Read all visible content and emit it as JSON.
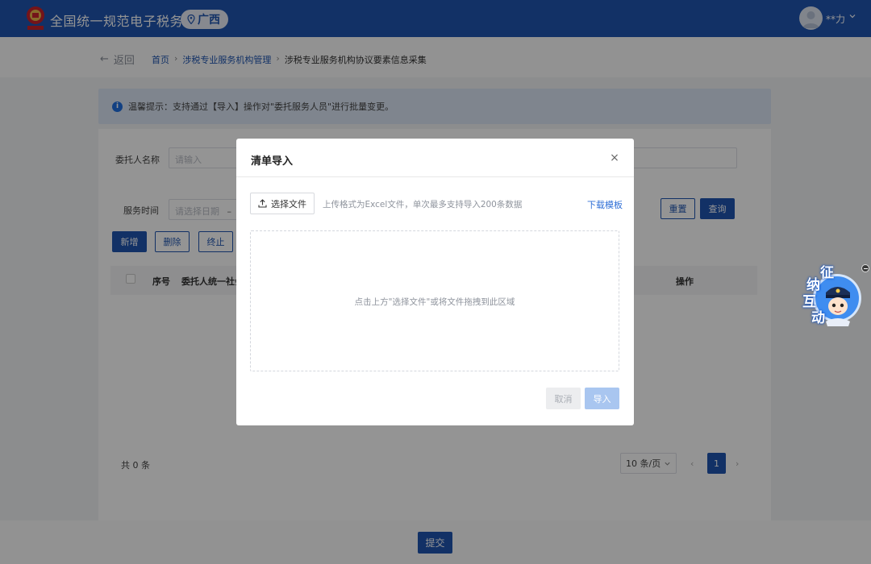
{
  "header": {
    "app_title": "全国统一规范电子税务局",
    "region": "广西",
    "user_name": "**力",
    "logo_icon": "tax-emblem-icon",
    "brand_color": "#1f55b0"
  },
  "nav": {
    "back_label": "返回",
    "breadcrumb": [
      "首页",
      "涉税专业服务机构管理",
      "涉税专业服务机构协议要素信息采集"
    ]
  },
  "tip": {
    "text": "温馨提示：支持通过【导入】操作对\"委托服务人员\"进行批量变更。"
  },
  "form": {
    "client_name_label": "委托人名称",
    "client_name_placeholder": "请输入",
    "service_time_label": "服务时间",
    "date_placeholder": "请选择日期",
    "date_sep": "–",
    "reset_label": "重置",
    "query_label": "查询"
  },
  "toolbar": {
    "add_label": "新增",
    "delete_label": "删除",
    "terminate_label": "终止"
  },
  "table": {
    "columns": [
      "序号",
      "委托人统一社会",
      "操作"
    ]
  },
  "pagination": {
    "total": "共 0 条",
    "page_size": "10 条/页",
    "current_page": "1",
    "prev": "‹",
    "next": "›"
  },
  "footer": {
    "submit_label": "提交"
  },
  "assistant": {
    "chars": [
      "征",
      "纳",
      "互",
      "动"
    ]
  },
  "modal": {
    "title": "清单导入",
    "close": "×",
    "choose_file_label": "选择文件",
    "upload_hint": "上传格式为Excel文件，单次最多支持导入200条数据",
    "download_template": "下载模板",
    "drop_hint": "点击上方\"选择文件\"或将文件拖拽到此区域",
    "cancel_label": "取消",
    "import_label": "导入"
  }
}
